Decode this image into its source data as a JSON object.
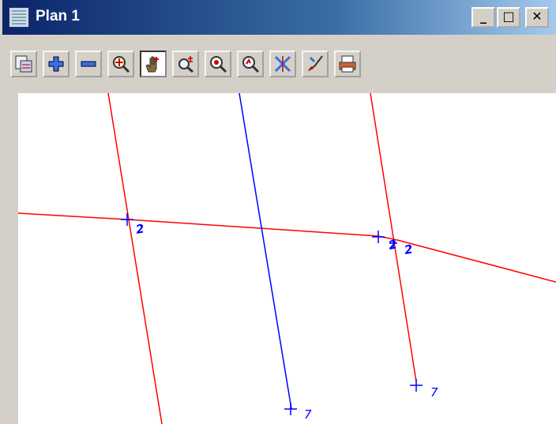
{
  "window": {
    "title": "Plan 1"
  },
  "title_buttons": {
    "minimize": "_",
    "maximize": "□",
    "close": "✕"
  },
  "toolbar": {
    "buttons": [
      {
        "icon": "display-views-icon"
      },
      {
        "icon": "zoom-in-plus-icon"
      },
      {
        "icon": "zoom-out-minus-icon"
      },
      {
        "icon": "extent-icon"
      },
      {
        "icon": "pan-hand-icon",
        "active": true
      },
      {
        "icon": "zoom-box-icon"
      },
      {
        "icon": "zoom-window-icon"
      },
      {
        "icon": "zoom-previous-icon"
      },
      {
        "icon": "cross-hair-icon"
      },
      {
        "icon": "pick-icon"
      },
      {
        "icon": "plot-print-icon"
      }
    ]
  },
  "canvas": {
    "labels": {
      "l1": "2",
      "l2": "2",
      "l3": "2",
      "l4": "7",
      "l5": "7"
    },
    "colors": {
      "red": "#ff0000",
      "blue": "#0000ff"
    }
  }
}
